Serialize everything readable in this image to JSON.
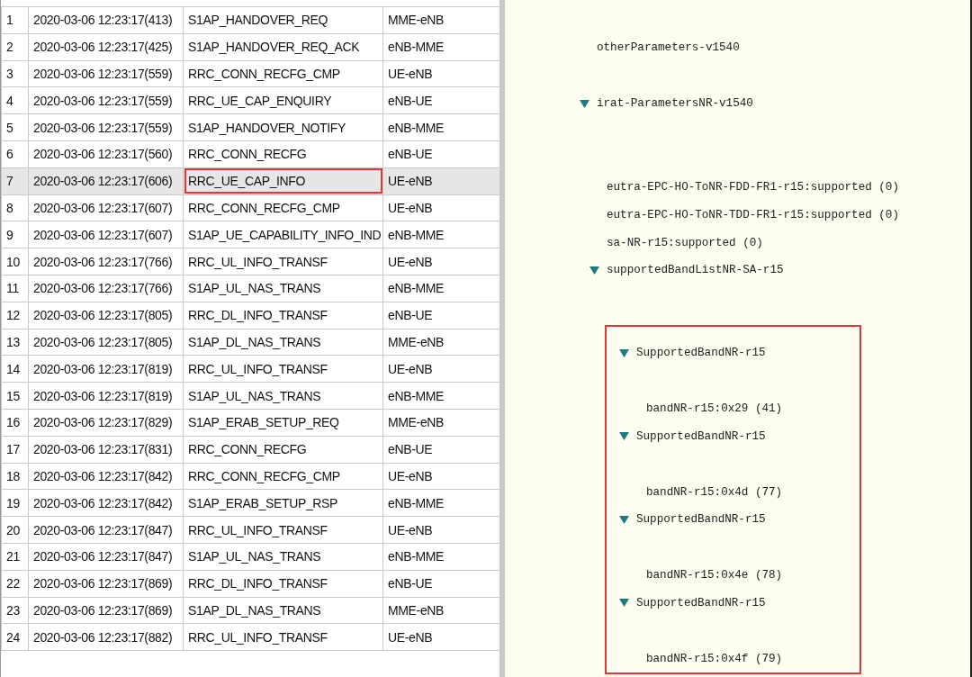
{
  "message_log": {
    "rows": [
      {
        "index": "1",
        "time": "2020-03-06 12:23:17(413)",
        "message": "S1AP_HANDOVER_REQ",
        "direction": "MME-eNB",
        "selected": false,
        "outlined": false
      },
      {
        "index": "2",
        "time": "2020-03-06 12:23:17(425)",
        "message": "S1AP_HANDOVER_REQ_ACK",
        "direction": "eNB-MME",
        "selected": false,
        "outlined": false
      },
      {
        "index": "3",
        "time": "2020-03-06 12:23:17(559)",
        "message": "RRC_CONN_RECFG_CMP",
        "direction": "UE-eNB",
        "selected": false,
        "outlined": false
      },
      {
        "index": "4",
        "time": "2020-03-06 12:23:17(559)",
        "message": "RRC_UE_CAP_ENQUIRY",
        "direction": "eNB-UE",
        "selected": false,
        "outlined": false
      },
      {
        "index": "5",
        "time": "2020-03-06 12:23:17(559)",
        "message": "S1AP_HANDOVER_NOTIFY",
        "direction": "eNB-MME",
        "selected": false,
        "outlined": false
      },
      {
        "index": "6",
        "time": "2020-03-06 12:23:17(560)",
        "message": "RRC_CONN_RECFG",
        "direction": "eNB-UE",
        "selected": false,
        "outlined": false
      },
      {
        "index": "7",
        "time": "2020-03-06 12:23:17(606)",
        "message": "RRC_UE_CAP_INFO",
        "direction": "UE-eNB",
        "selected": true,
        "outlined": true
      },
      {
        "index": "8",
        "time": "2020-03-06 12:23:17(607)",
        "message": "RRC_CONN_RECFG_CMP",
        "direction": "UE-eNB",
        "selected": false,
        "outlined": false
      },
      {
        "index": "9",
        "time": "2020-03-06 12:23:17(607)",
        "message": "S1AP_UE_CAPABILITY_INFO_IND",
        "direction": "eNB-MME",
        "selected": false,
        "outlined": false
      },
      {
        "index": "10",
        "time": "2020-03-06 12:23:17(766)",
        "message": "RRC_UL_INFO_TRANSF",
        "direction": "UE-eNB",
        "selected": false,
        "outlined": false
      },
      {
        "index": "11",
        "time": "2020-03-06 12:23:17(766)",
        "message": "S1AP_UL_NAS_TRANS",
        "direction": "eNB-MME",
        "selected": false,
        "outlined": false
      },
      {
        "index": "12",
        "time": "2020-03-06 12:23:17(805)",
        "message": "RRC_DL_INFO_TRANSF",
        "direction": "eNB-UE",
        "selected": false,
        "outlined": false
      },
      {
        "index": "13",
        "time": "2020-03-06 12:23:17(805)",
        "message": "S1AP_DL_NAS_TRANS",
        "direction": "MME-eNB",
        "selected": false,
        "outlined": false
      },
      {
        "index": "14",
        "time": "2020-03-06 12:23:17(819)",
        "message": "RRC_UL_INFO_TRANSF",
        "direction": "UE-eNB",
        "selected": false,
        "outlined": false
      },
      {
        "index": "15",
        "time": "2020-03-06 12:23:17(819)",
        "message": "S1AP_UL_NAS_TRANS",
        "direction": "eNB-MME",
        "selected": false,
        "outlined": false
      },
      {
        "index": "16",
        "time": "2020-03-06 12:23:17(829)",
        "message": "S1AP_ERAB_SETUP_REQ",
        "direction": "MME-eNB",
        "selected": false,
        "outlined": false
      },
      {
        "index": "17",
        "time": "2020-03-06 12:23:17(831)",
        "message": "RRC_CONN_RECFG",
        "direction": "eNB-UE",
        "selected": false,
        "outlined": false
      },
      {
        "index": "18",
        "time": "2020-03-06 12:23:17(842)",
        "message": "RRC_CONN_RECFG_CMP",
        "direction": "UE-eNB",
        "selected": false,
        "outlined": false
      },
      {
        "index": "19",
        "time": "2020-03-06 12:23:17(842)",
        "message": "S1AP_ERAB_SETUP_RSP",
        "direction": "eNB-MME",
        "selected": false,
        "outlined": false
      },
      {
        "index": "20",
        "time": "2020-03-06 12:23:17(847)",
        "message": "RRC_UL_INFO_TRANSF",
        "direction": "UE-eNB",
        "selected": false,
        "outlined": false
      },
      {
        "index": "21",
        "time": "2020-03-06 12:23:17(847)",
        "message": "S1AP_UL_NAS_TRANS",
        "direction": "eNB-MME",
        "selected": false,
        "outlined": false
      },
      {
        "index": "22",
        "time": "2020-03-06 12:23:17(869)",
        "message": "RRC_DL_INFO_TRANSF",
        "direction": "eNB-UE",
        "selected": false,
        "outlined": false
      },
      {
        "index": "23",
        "time": "2020-03-06 12:23:17(869)",
        "message": "S1AP_DL_NAS_TRANS",
        "direction": "MME-eNB",
        "selected": false,
        "outlined": false
      },
      {
        "index": "24",
        "time": "2020-03-06 12:23:17(882)",
        "message": "RRC_UL_INFO_TRANSF",
        "direction": "UE-eNB",
        "selected": false,
        "outlined": false
      }
    ]
  },
  "decode_tree": {
    "nodes": [
      {
        "label": "otherParameters-v1540"
      },
      {
        "label": "irat-ParametersNR-v1540",
        "expanded": true,
        "outlined": false,
        "children": [
          {
            "label": "eutra-EPC-HO-ToNR-FDD-FR1-r15:supported (0)"
          },
          {
            "label": "eutra-EPC-HO-ToNR-TDD-FR1-r15:supported (0)"
          },
          {
            "label": "sa-NR-r15:supported (0)"
          },
          {
            "label": "supportedBandListNR-SA-r15",
            "expanded": true,
            "outlined": true,
            "children": [
              {
                "label": "SupportedBandNR-r15",
                "expanded": true,
                "outlined": false,
                "children": [
                  {
                    "label": "bandNR-r15:0x29 (41)"
                  }
                ]
              },
              {
                "label": "SupportedBandNR-r15",
                "expanded": true,
                "outlined": false,
                "children": [
                  {
                    "label": "bandNR-r15:0x4d (77)"
                  }
                ]
              },
              {
                "label": "SupportedBandNR-r15",
                "expanded": true,
                "outlined": false,
                "children": [
                  {
                    "label": "bandNR-r15:0x4e (78)"
                  }
                ]
              },
              {
                "label": "SupportedBandNR-r15",
                "expanded": true,
                "outlined": false,
                "children": [
                  {
                    "label": "bandNR-r15:0x4f (79)"
                  }
                ]
              }
            ]
          }
        ]
      }
    ]
  }
}
